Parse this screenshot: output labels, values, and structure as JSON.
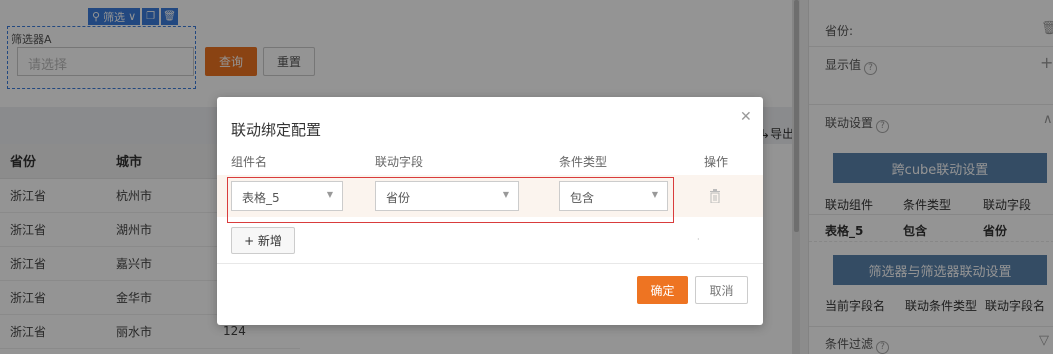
{
  "canvas": {
    "toolbar": {
      "filter_label": "筛选",
      "filter_icon": "filter-icon",
      "chevron_icon": "chevron-down-icon",
      "copy_icon": "copy-icon",
      "delete_icon": "trash-icon"
    },
    "filter_widget": {
      "title": "筛选器A",
      "placeholder": "请选择"
    },
    "query_button": "查询",
    "reset_button": "重置",
    "export_label": "导出",
    "table": {
      "headers": [
        "省份",
        "城市",
        ""
      ],
      "rows": [
        [
          "浙江省",
          "杭州市",
          ""
        ],
        [
          "浙江省",
          "湖州市",
          ""
        ],
        [
          "浙江省",
          "嘉兴市",
          ""
        ],
        [
          "浙江省",
          "金华市",
          ""
        ],
        [
          "浙江省",
          "丽水市",
          "124"
        ]
      ]
    }
  },
  "panel": {
    "province_label": "省份:",
    "display_value_label": "显示值",
    "linkage_settings_label": "联动设置",
    "cross_cube_button": "跨cube联动设置",
    "link_table_headers": [
      "联动组件",
      "条件类型",
      "联动字段"
    ],
    "link_table_row": [
      "表格_5",
      "包含",
      "省份"
    ],
    "filter_link_button": "筛选器与筛选器联动设置",
    "filter_link_headers": [
      "当前字段名",
      "联动条件类型",
      "联动字段名"
    ],
    "condition_filter_label": "条件过滤"
  },
  "dialog": {
    "title": "联动绑定配置",
    "columns": [
      "组件名",
      "联动字段",
      "条件类型",
      "操作"
    ],
    "row": {
      "component": "表格_5",
      "field": "省份",
      "condition": "包含"
    },
    "add_button": "+ 新增",
    "ok_button": "确定",
    "cancel_button": "取消",
    "accent_color": "#ee7422",
    "highlight_color": "#d93c3c"
  }
}
